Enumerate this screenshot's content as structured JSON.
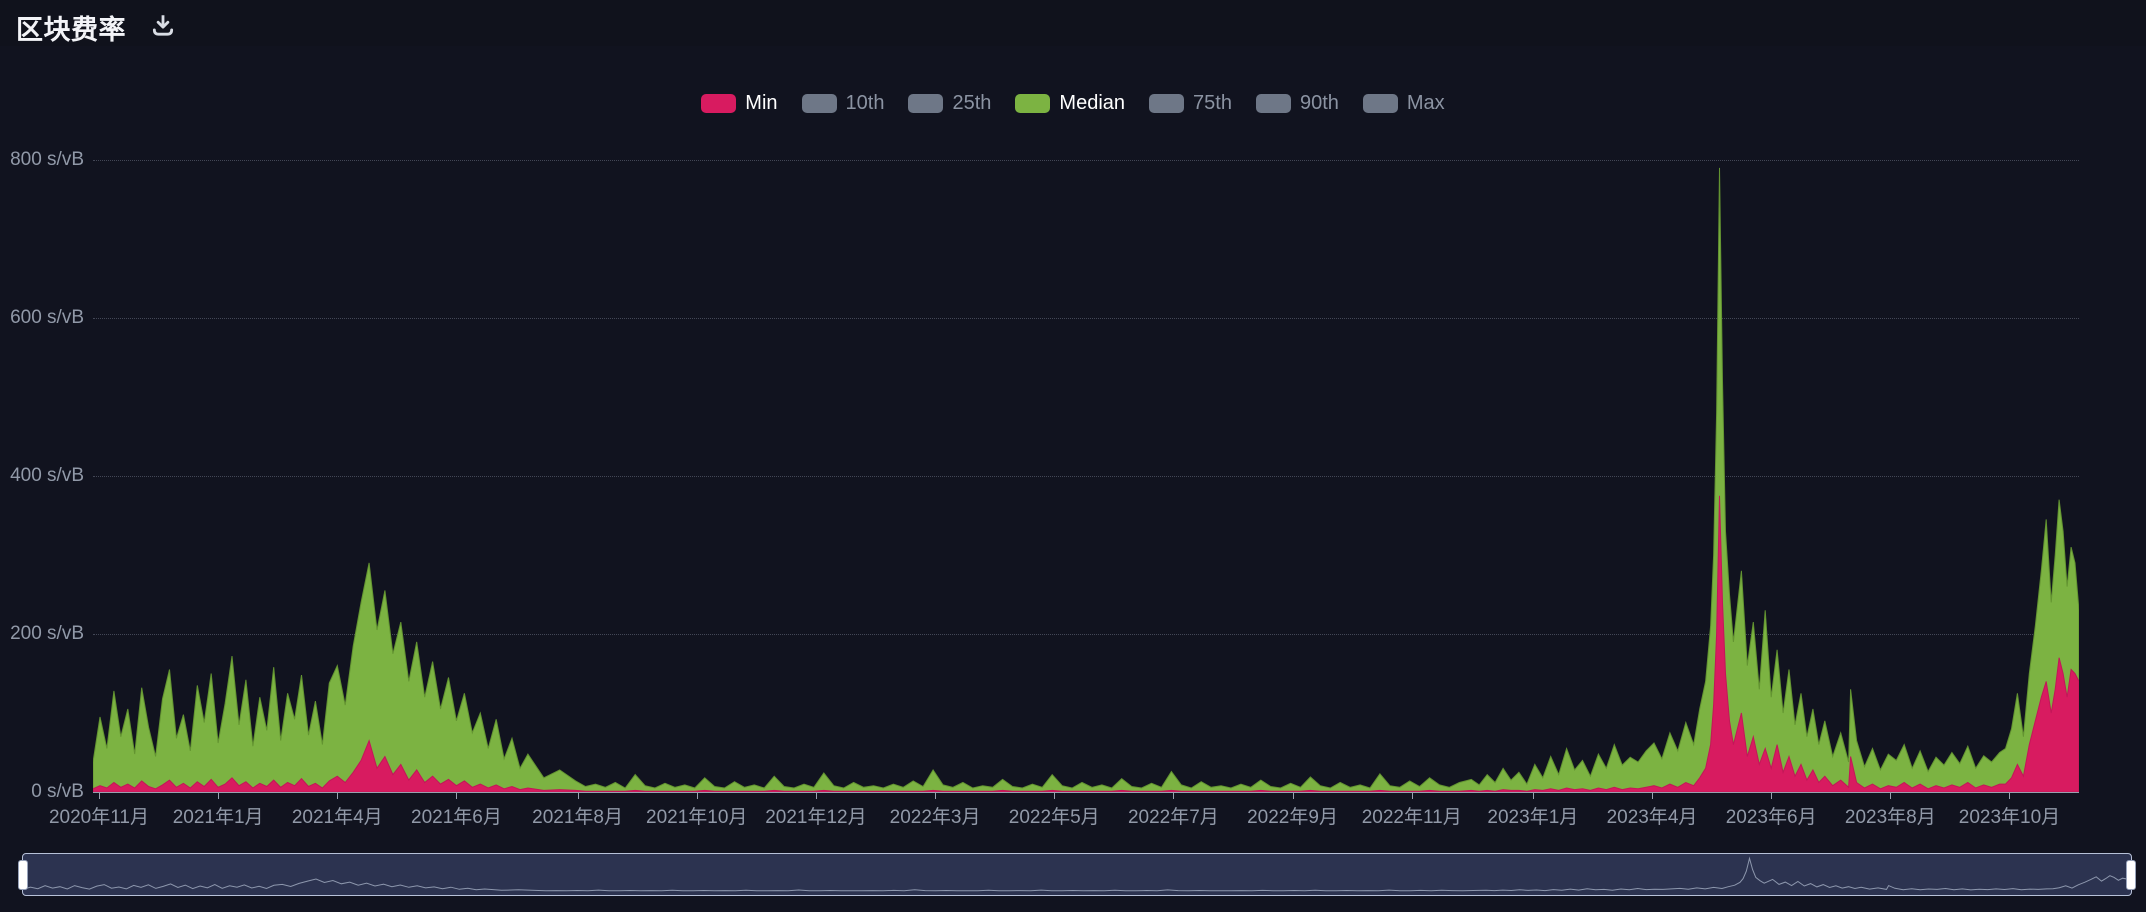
{
  "header": {
    "title": "区块费率",
    "download_tooltip": "download"
  },
  "legend": {
    "items": [
      {
        "label": "Min",
        "color": "#D81B60",
        "active": true
      },
      {
        "label": "10th",
        "color": "#6e7787",
        "active": false
      },
      {
        "label": "25th",
        "color": "#6e7787",
        "active": false
      },
      {
        "label": "Median",
        "color": "#7CB342",
        "active": true
      },
      {
        "label": "75th",
        "color": "#6e7787",
        "active": false
      },
      {
        "label": "90th",
        "color": "#6e7787",
        "active": false
      },
      {
        "label": "Max",
        "color": "#6e7787",
        "active": false
      }
    ]
  },
  "y_axis": {
    "unit": "s/vB",
    "ticks": [
      {
        "value": 0,
        "label": "0 s/vB"
      },
      {
        "value": 200,
        "label": "200 s/vB"
      },
      {
        "value": 400,
        "label": "400 s/vB"
      },
      {
        "value": 600,
        "label": "600 s/vB"
      },
      {
        "value": 800,
        "label": "800 s/vB"
      }
    ]
  },
  "chart_data": {
    "type": "area",
    "title": "区块费率",
    "ylabel": "s/vB",
    "ylim": [
      0,
      800
    ],
    "grid": "dotted-horizontal",
    "legend_position": "top-center",
    "x_labels": [
      {
        "label": "2020年11月",
        "frac": 0.003
      },
      {
        "label": "2021年1月",
        "frac": 0.063
      },
      {
        "label": "2021年4月",
        "frac": 0.123
      },
      {
        "label": "2021年6月",
        "frac": 0.183
      },
      {
        "label": "2021年8月",
        "frac": 0.244
      },
      {
        "label": "2021年10月",
        "frac": 0.304
      },
      {
        "label": "2021年12月",
        "frac": 0.364
      },
      {
        "label": "2022年3月",
        "frac": 0.424
      },
      {
        "label": "2022年5月",
        "frac": 0.484
      },
      {
        "label": "2022年7月",
        "frac": 0.544
      },
      {
        "label": "2022年9月",
        "frac": 0.604
      },
      {
        "label": "2022年11月",
        "frac": 0.664
      },
      {
        "label": "2023年1月",
        "frac": 0.725
      },
      {
        "label": "2023年4月",
        "frac": 0.785
      },
      {
        "label": "2023年6月",
        "frac": 0.845
      },
      {
        "label": "2023年8月",
        "frac": 0.905
      },
      {
        "label": "2023年10月",
        "frac": 0.965
      }
    ],
    "series": [
      {
        "name": "Min",
        "color": "#D81B60",
        "stroke": "#c21758",
        "active": true
      },
      {
        "name": "Median",
        "color": "#7CB342",
        "stroke": "#639431",
        "active": true
      }
    ],
    "points_format": [
      "x_fraction",
      "min_svb",
      "median_svb"
    ],
    "points": [
      [
        0.0,
        4,
        38
      ],
      [
        0.0035,
        8,
        95
      ],
      [
        0.007,
        5,
        55
      ],
      [
        0.0105,
        12,
        128
      ],
      [
        0.014,
        6,
        70
      ],
      [
        0.0175,
        10,
        105
      ],
      [
        0.021,
        5,
        48
      ],
      [
        0.0245,
        14,
        132
      ],
      [
        0.028,
        7,
        82
      ],
      [
        0.0315,
        4,
        45
      ],
      [
        0.035,
        9,
        118
      ],
      [
        0.0385,
        15,
        155
      ],
      [
        0.042,
        6,
        68
      ],
      [
        0.0455,
        11,
        98
      ],
      [
        0.049,
        5,
        52
      ],
      [
        0.0525,
        13,
        135
      ],
      [
        0.056,
        7,
        88
      ],
      [
        0.0595,
        16,
        150
      ],
      [
        0.063,
        6,
        62
      ],
      [
        0.0665,
        10,
        112
      ],
      [
        0.07,
        18,
        172
      ],
      [
        0.0735,
        8,
        85
      ],
      [
        0.077,
        13,
        142
      ],
      [
        0.0805,
        5,
        58
      ],
      [
        0.084,
        11,
        120
      ],
      [
        0.0875,
        7,
        78
      ],
      [
        0.091,
        15,
        158
      ],
      [
        0.0945,
        6,
        65
      ],
      [
        0.098,
        12,
        125
      ],
      [
        0.1015,
        8,
        92
      ],
      [
        0.105,
        17,
        148
      ],
      [
        0.1085,
        7,
        72
      ],
      [
        0.112,
        11,
        115
      ],
      [
        0.1155,
        5,
        60
      ],
      [
        0.119,
        14,
        138
      ],
      [
        0.123,
        20,
        160
      ],
      [
        0.127,
        12,
        110
      ],
      [
        0.131,
        25,
        185
      ],
      [
        0.135,
        40,
        240
      ],
      [
        0.139,
        65,
        290
      ],
      [
        0.143,
        30,
        205
      ],
      [
        0.147,
        45,
        255
      ],
      [
        0.151,
        22,
        175
      ],
      [
        0.155,
        35,
        215
      ],
      [
        0.159,
        15,
        140
      ],
      [
        0.163,
        28,
        190
      ],
      [
        0.167,
        12,
        120
      ],
      [
        0.171,
        20,
        165
      ],
      [
        0.175,
        10,
        105
      ],
      [
        0.179,
        16,
        145
      ],
      [
        0.183,
        8,
        90
      ],
      [
        0.187,
        14,
        125
      ],
      [
        0.191,
        6,
        75
      ],
      [
        0.195,
        10,
        100
      ],
      [
        0.199,
        5,
        55
      ],
      [
        0.203,
        9,
        92
      ],
      [
        0.207,
        4,
        42
      ],
      [
        0.211,
        7,
        68
      ],
      [
        0.215,
        3,
        30
      ],
      [
        0.219,
        5,
        48
      ],
      [
        0.227,
        2,
        18
      ],
      [
        0.235,
        3,
        28
      ],
      [
        0.243,
        2,
        14
      ],
      [
        0.248,
        1,
        7
      ],
      [
        0.253,
        1,
        10
      ],
      [
        0.258,
        1,
        6
      ],
      [
        0.263,
        1,
        12
      ],
      [
        0.268,
        1,
        5
      ],
      [
        0.273,
        2,
        22
      ],
      [
        0.278,
        1,
        8
      ],
      [
        0.283,
        1,
        5
      ],
      [
        0.288,
        1,
        11
      ],
      [
        0.293,
        1,
        6
      ],
      [
        0.298,
        1,
        9
      ],
      [
        0.303,
        1,
        5
      ],
      [
        0.308,
        2,
        18
      ],
      [
        0.313,
        1,
        7
      ],
      [
        0.318,
        1,
        5
      ],
      [
        0.323,
        1,
        13
      ],
      [
        0.328,
        1,
        6
      ],
      [
        0.333,
        1,
        9
      ],
      [
        0.338,
        1,
        5
      ],
      [
        0.343,
        2,
        20
      ],
      [
        0.348,
        1,
        7
      ],
      [
        0.353,
        1,
        5
      ],
      [
        0.358,
        1,
        10
      ],
      [
        0.363,
        1,
        6
      ],
      [
        0.368,
        2,
        24
      ],
      [
        0.373,
        1,
        8
      ],
      [
        0.378,
        1,
        5
      ],
      [
        0.383,
        1,
        12
      ],
      [
        0.388,
        1,
        6
      ],
      [
        0.393,
        1,
        8
      ],
      [
        0.398,
        1,
        5
      ],
      [
        0.403,
        1,
        10
      ],
      [
        0.408,
        1,
        6
      ],
      [
        0.413,
        1,
        14
      ],
      [
        0.418,
        1,
        7
      ],
      [
        0.423,
        2,
        28
      ],
      [
        0.428,
        1,
        9
      ],
      [
        0.433,
        1,
        6
      ],
      [
        0.438,
        1,
        12
      ],
      [
        0.443,
        1,
        5
      ],
      [
        0.448,
        1,
        8
      ],
      [
        0.453,
        1,
        6
      ],
      [
        0.458,
        2,
        16
      ],
      [
        0.463,
        1,
        7
      ],
      [
        0.468,
        1,
        5
      ],
      [
        0.473,
        1,
        10
      ],
      [
        0.478,
        1,
        6
      ],
      [
        0.483,
        2,
        22
      ],
      [
        0.488,
        1,
        8
      ],
      [
        0.493,
        1,
        5
      ],
      [
        0.498,
        1,
        12
      ],
      [
        0.503,
        1,
        6
      ],
      [
        0.508,
        1,
        9
      ],
      [
        0.513,
        1,
        5
      ],
      [
        0.518,
        2,
        17
      ],
      [
        0.523,
        1,
        7
      ],
      [
        0.528,
        1,
        5
      ],
      [
        0.533,
        1,
        11
      ],
      [
        0.538,
        1,
        6
      ],
      [
        0.543,
        2,
        26
      ],
      [
        0.548,
        1,
        9
      ],
      [
        0.553,
        1,
        5
      ],
      [
        0.558,
        1,
        13
      ],
      [
        0.563,
        1,
        6
      ],
      [
        0.568,
        1,
        8
      ],
      [
        0.573,
        1,
        5
      ],
      [
        0.578,
        1,
        10
      ],
      [
        0.583,
        1,
        6
      ],
      [
        0.588,
        2,
        15
      ],
      [
        0.593,
        1,
        7
      ],
      [
        0.598,
        1,
        5
      ],
      [
        0.603,
        1,
        11
      ],
      [
        0.608,
        1,
        6
      ],
      [
        0.613,
        2,
        19
      ],
      [
        0.618,
        1,
        8
      ],
      [
        0.623,
        1,
        5
      ],
      [
        0.628,
        1,
        12
      ],
      [
        0.633,
        1,
        6
      ],
      [
        0.638,
        1,
        9
      ],
      [
        0.643,
        1,
        5
      ],
      [
        0.648,
        2,
        23
      ],
      [
        0.653,
        1,
        8
      ],
      [
        0.658,
        1,
        6
      ],
      [
        0.663,
        1,
        14
      ],
      [
        0.668,
        1,
        7
      ],
      [
        0.673,
        2,
        18
      ],
      [
        0.678,
        1,
        9
      ],
      [
        0.683,
        1,
        6
      ],
      [
        0.688,
        1,
        12
      ],
      [
        0.694,
        2,
        16
      ],
      [
        0.698,
        1,
        9
      ],
      [
        0.702,
        2,
        22
      ],
      [
        0.706,
        1,
        12
      ],
      [
        0.71,
        3,
        30
      ],
      [
        0.714,
        2,
        15
      ],
      [
        0.718,
        2,
        25
      ],
      [
        0.722,
        1,
        10
      ],
      [
        0.726,
        3,
        35
      ],
      [
        0.73,
        2,
        18
      ],
      [
        0.734,
        4,
        45
      ],
      [
        0.738,
        2,
        22
      ],
      [
        0.742,
        5,
        55
      ],
      [
        0.746,
        3,
        28
      ],
      [
        0.75,
        4,
        40
      ],
      [
        0.754,
        2,
        20
      ],
      [
        0.758,
        5,
        48
      ],
      [
        0.762,
        3,
        30
      ],
      [
        0.766,
        6,
        60
      ],
      [
        0.77,
        3,
        34
      ],
      [
        0.774,
        5,
        44
      ],
      [
        0.778,
        4,
        38
      ],
      [
        0.782,
        6,
        52
      ],
      [
        0.786,
        8,
        62
      ],
      [
        0.79,
        5,
        42
      ],
      [
        0.794,
        10,
        75
      ],
      [
        0.798,
        6,
        52
      ],
      [
        0.802,
        12,
        88
      ],
      [
        0.806,
        8,
        60
      ],
      [
        0.809,
        18,
        105
      ],
      [
        0.812,
        30,
        140
      ],
      [
        0.8145,
        60,
        210
      ],
      [
        0.816,
        110,
        300
      ],
      [
        0.8175,
        200,
        480
      ],
      [
        0.819,
        375,
        790
      ],
      [
        0.8205,
        240,
        520
      ],
      [
        0.822,
        150,
        330
      ],
      [
        0.824,
        90,
        250
      ],
      [
        0.826,
        60,
        190
      ],
      [
        0.83,
        100,
        280
      ],
      [
        0.833,
        45,
        160
      ],
      [
        0.836,
        70,
        215
      ],
      [
        0.839,
        35,
        130
      ],
      [
        0.842,
        55,
        230
      ],
      [
        0.845,
        30,
        120
      ],
      [
        0.848,
        60,
        180
      ],
      [
        0.851,
        25,
        100
      ],
      [
        0.854,
        45,
        155
      ],
      [
        0.857,
        20,
        85
      ],
      [
        0.86,
        35,
        125
      ],
      [
        0.863,
        15,
        70
      ],
      [
        0.866,
        28,
        105
      ],
      [
        0.869,
        12,
        60
      ],
      [
        0.872,
        20,
        90
      ],
      [
        0.876,
        8,
        45
      ],
      [
        0.88,
        15,
        75
      ],
      [
        0.884,
        6,
        38
      ],
      [
        0.885,
        45,
        130
      ],
      [
        0.888,
        12,
        65
      ],
      [
        0.892,
        5,
        32
      ],
      [
        0.896,
        10,
        55
      ],
      [
        0.9,
        4,
        28
      ],
      [
        0.904,
        8,
        48
      ],
      [
        0.908,
        6,
        40
      ],
      [
        0.912,
        12,
        60
      ],
      [
        0.916,
        5,
        30
      ],
      [
        0.92,
        10,
        52
      ],
      [
        0.924,
        4,
        26
      ],
      [
        0.928,
        8,
        44
      ],
      [
        0.932,
        5,
        34
      ],
      [
        0.936,
        9,
        50
      ],
      [
        0.94,
        6,
        36
      ],
      [
        0.944,
        12,
        58
      ],
      [
        0.948,
        5,
        30
      ],
      [
        0.952,
        9,
        46
      ],
      [
        0.956,
        6,
        38
      ],
      [
        0.96,
        10,
        50
      ],
      [
        0.963,
        10,
        55
      ],
      [
        0.966,
        18,
        80
      ],
      [
        0.969,
        35,
        125
      ],
      [
        0.972,
        20,
        70
      ],
      [
        0.975,
        60,
        150
      ],
      [
        0.978,
        90,
        210
      ],
      [
        0.981,
        120,
        280
      ],
      [
        0.9835,
        140,
        345
      ],
      [
        0.986,
        100,
        240
      ],
      [
        0.988,
        130,
        300
      ],
      [
        0.99,
        170,
        370
      ],
      [
        0.992,
        150,
        330
      ],
      [
        0.994,
        120,
        260
      ],
      [
        0.996,
        155,
        310
      ],
      [
        0.998,
        150,
        290
      ],
      [
        1.0,
        140,
        230
      ]
    ]
  },
  "navigator": {
    "range_selected": "full",
    "line_color": "#8d97ad",
    "handles": [
      "left",
      "right"
    ]
  },
  "colors": {
    "background": "#11131f",
    "min": "#D81B60",
    "median": "#7CB342",
    "axis_text": "#9199a8",
    "navigator_fill": "#2c3350"
  }
}
